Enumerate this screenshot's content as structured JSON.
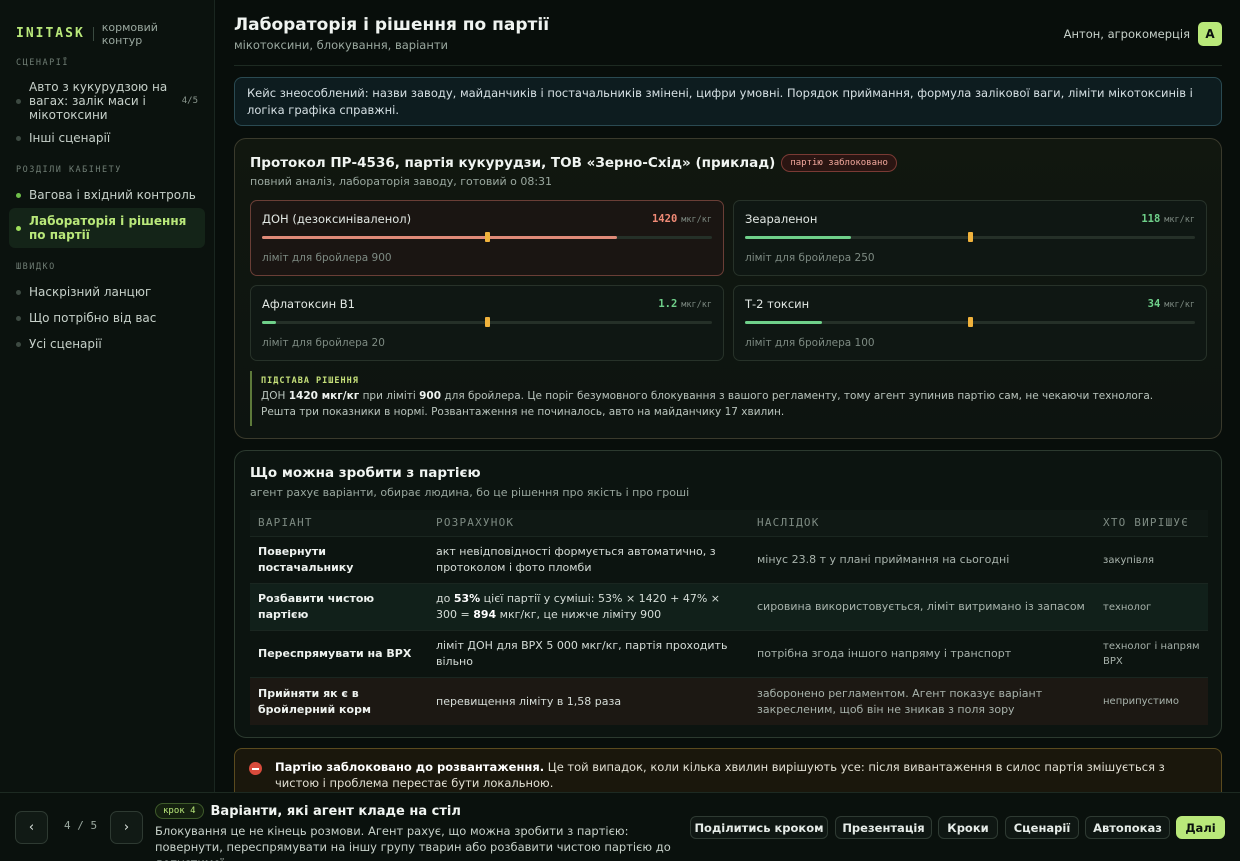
{
  "brand": {
    "name": "INITASK",
    "sub": "кормовий контур"
  },
  "sidebar": {
    "sec_scenarios": "СЦЕНАРІЇ",
    "scenario_items": [
      {
        "label": "Авто з кукурудзою на вагах: залік маси і мікотоксини",
        "count": "4/5"
      },
      {
        "label": "Інші сценарії"
      }
    ],
    "sec_sections": "РОЗДІЛИ КАБІНЕТУ",
    "section_items": [
      {
        "label": "Вагова і вхідний контроль"
      },
      {
        "label": "Лабораторія і рішення по партії"
      }
    ],
    "sec_quick": "ШВИДКО",
    "quick_items": [
      {
        "label": "Наскрізний ланцюг"
      },
      {
        "label": "Що потрібно від вас"
      },
      {
        "label": "Усі сценарії"
      }
    ]
  },
  "header": {
    "title": "Лабораторія і рішення по партії",
    "subtitle": "мікотоксини, блокування, варіанти",
    "user": "Антон, агрокомерція",
    "avatar": "А"
  },
  "notice": "Кейс знеособлений: назви заводу, майданчиків і постачальників змінені, цифри умовні. Порядок приймання, формула залікової ваги, ліміти мікотоксинів і логіка графіка справжні.",
  "protocol": {
    "title": "Протокол ПР-4536, партія кукурудзи, ТОВ «Зерно-Схід» (приклад)",
    "badge": "партію заблоковано",
    "subtitle": "повний аналіз, лабораторія заводу, готовий о 08:31",
    "toxins": [
      {
        "name": "ДОН (дезоксиніваленол)",
        "value": "1420",
        "unit": "мкг/кг",
        "limit_text": "ліміт для бройлера 900",
        "ratio": 1.578,
        "status": "bad"
      },
      {
        "name": "Зеараленон",
        "value": "118",
        "unit": "мкг/кг",
        "limit_text": "ліміт для бройлера 250",
        "ratio": 0.472,
        "status": "ok"
      },
      {
        "name": "Афлатоксин B1",
        "value": "1.2",
        "unit": "мкг/кг",
        "limit_text": "ліміт для бройлера 20",
        "ratio": 0.06,
        "status": "ok"
      },
      {
        "name": "Т-2 токсин",
        "value": "34",
        "unit": "мкг/кг",
        "limit_text": "ліміт для бройлера 100",
        "ratio": 0.34,
        "status": "ok"
      }
    ],
    "basis": {
      "label": "ПІДСТАВА РІШЕННЯ",
      "p1": "ДОН ",
      "b1": "1420 мкг/кг",
      "p2": " при ліміті ",
      "b2": "900",
      "p3": " для бройлера. Це поріг безумовного блокування з вашого регламенту, тому агент зупинив партію сам, не чекаючи технолога. Решта три показники в нормі. Розвантаження не починалось, авто на майданчику 17 хвилин."
    }
  },
  "options": {
    "title": "Що можна зробити з партією",
    "subtitle": "агент рахує варіанти, обирає людина, бо це рішення про якість і про гроші",
    "headers": [
      "ВАРІАНТ",
      "РОЗРАХУНОК",
      "НАСЛІДОК",
      "ХТО ВИРІШУЄ"
    ],
    "rows": [
      {
        "variant": "Повернути постачальнику",
        "calc": "акт невідповідності формується автоматично, з протоколом і фото пломби",
        "result": "мінус 23.8 т у плані приймання на сьогодні",
        "who": "закупівля"
      },
      {
        "variant": "Розбавити чистою партією",
        "calc_a": "до ",
        "calc_b": "53%",
        "calc_c": " цієї партії у суміші: 53% × 1420 + 47% × 300 = ",
        "calc_d": "894",
        "calc_e": " мкг/кг, це нижче ліміту 900",
        "result": "сировина використовується, ліміт витримано із запасом",
        "who": "технолог"
      },
      {
        "variant": "Переспрямувати на ВРХ",
        "calc": "ліміт ДОН для ВРХ 5 000 мкг/кг, партія проходить вільно",
        "result": "потрібна згода іншого напряму і транспорт",
        "who": "технолог і напрям ВРХ"
      },
      {
        "variant": "Прийняти як є в бройлерний корм",
        "calc": "перевищення ліміту в 1,58 раза",
        "result": "заборонено регламентом. Агент показує варіант закресленим, щоб він не зникав з поля зору",
        "who": "неприпустимо"
      }
    ]
  },
  "alert": {
    "bold": "Партію заблоковано до розвантаження.",
    "text": " Це той випадок, коли кілька хвилин вирішують усе: після вивантаження в силос партія змішується з чистою і проблема перестає бути локальною."
  },
  "footer": {
    "prev": "‹",
    "next": "›",
    "page": "4 / 5",
    "step_chip": "крок 4",
    "step_title": "Варіанти, які агент кладе на стіл",
    "step_desc": "Блокування це не кінець розмови. Агент рахує, що можна зробити з партією: повернути, переспрямувати на іншу групу тварин або розбавити чистою партією до допустимої...",
    "buttons": [
      "Поділитись кроком",
      "Презентація",
      "Кроки",
      "Сценарії",
      "Автопоказ",
      "Далі"
    ]
  },
  "colors": {
    "accent": "#b9e87a",
    "bad": "#e08a78",
    "ok": "#6fd08a",
    "limit_marker": "#f0b23c"
  }
}
